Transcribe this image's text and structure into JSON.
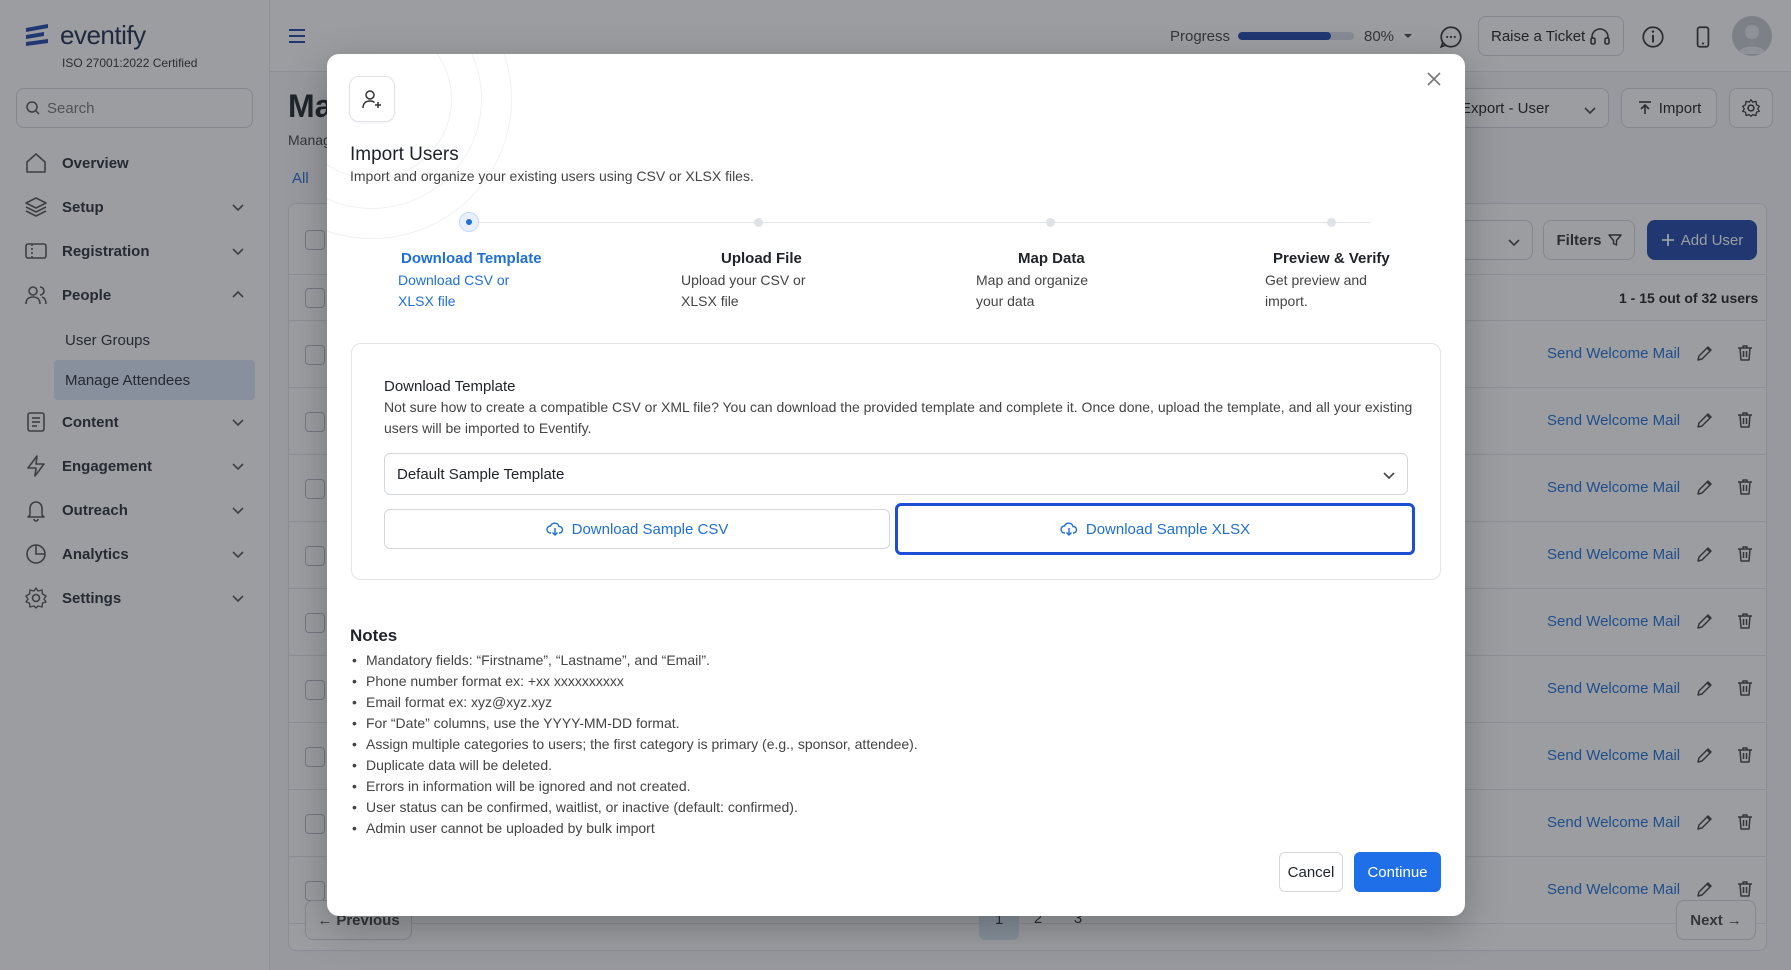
{
  "brand": {
    "name": "eventify",
    "cert": "ISO 27001:2022 Certified"
  },
  "search": {
    "placeholder": "Search"
  },
  "sidebar": {
    "items": [
      {
        "label": "Overview"
      },
      {
        "label": "Setup"
      },
      {
        "label": "Registration"
      },
      {
        "label": "People"
      },
      {
        "label": "Content"
      },
      {
        "label": "Engagement"
      },
      {
        "label": "Outreach"
      },
      {
        "label": "Analytics"
      },
      {
        "label": "Settings"
      }
    ],
    "people_sub": [
      {
        "label": "User Groups"
      },
      {
        "label": "Manage Attendees"
      }
    ]
  },
  "topbar": {
    "progress_label": "Progress",
    "progress_value": 80,
    "progress_pct": "80%",
    "ticket_label": "Raise a Ticket"
  },
  "page": {
    "title": "Ma",
    "subtitle": "Manag",
    "tab_all": "All",
    "export_label": "Export - User",
    "import_label": "Import",
    "filters_label": "Filters",
    "add_user_label": "Add User",
    "count_text": "1 - 15 out of 32 users",
    "welcome_label": "Send Welcome Mail",
    "prev_label": "Previous",
    "next_label": "Next",
    "pages": [
      "1",
      "2",
      "3"
    ]
  },
  "modal": {
    "title": "Import Users",
    "description": "Import and organize your existing users using CSV or XLSX files.",
    "steps": [
      {
        "title": "Download Template",
        "desc": "Download CSV or XLSX file"
      },
      {
        "title": "Upload File",
        "desc": "Upload your CSV or XLSX file"
      },
      {
        "title": "Map Data",
        "desc": "Map and organize your data"
      },
      {
        "title": "Preview & Verify",
        "desc": "Get preview and import."
      }
    ],
    "download": {
      "title": "Download Template",
      "desc": "Not sure how to create a compatible CSV or XML file? You can download the provided template and complete it. Once done, upload the template, and all your existing users will be imported to Eventify.",
      "select_value": "Default Sample Template",
      "csv_label": "Download Sample CSV",
      "xlsx_label": "Download Sample XLSX"
    },
    "notes_title": "Notes",
    "notes": [
      "Mandatory fields: “Firstname”, “Lastname”, and “Email”.",
      "Phone number format ex: +xx xxxxxxxxxx",
      "Email format ex: xyz@xyz.xyz",
      "For “Date” columns, use the YYYY-MM-DD format.",
      "Assign multiple categories to users; the first category is primary (e.g., sponsor, attendee).",
      "Duplicate data will be deleted.",
      "Errors in information will be ignored and not created.",
      "User status can be confirmed, waitlist, or inactive (default: confirmed).",
      "Admin user cannot be uploaded by bulk import"
    ],
    "cancel_label": "Cancel",
    "continue_label": "Continue"
  },
  "colors": {
    "accent": "#1f6fd8",
    "primary_button": "#1f6fe8",
    "brand_dark": "#1f45a8"
  }
}
